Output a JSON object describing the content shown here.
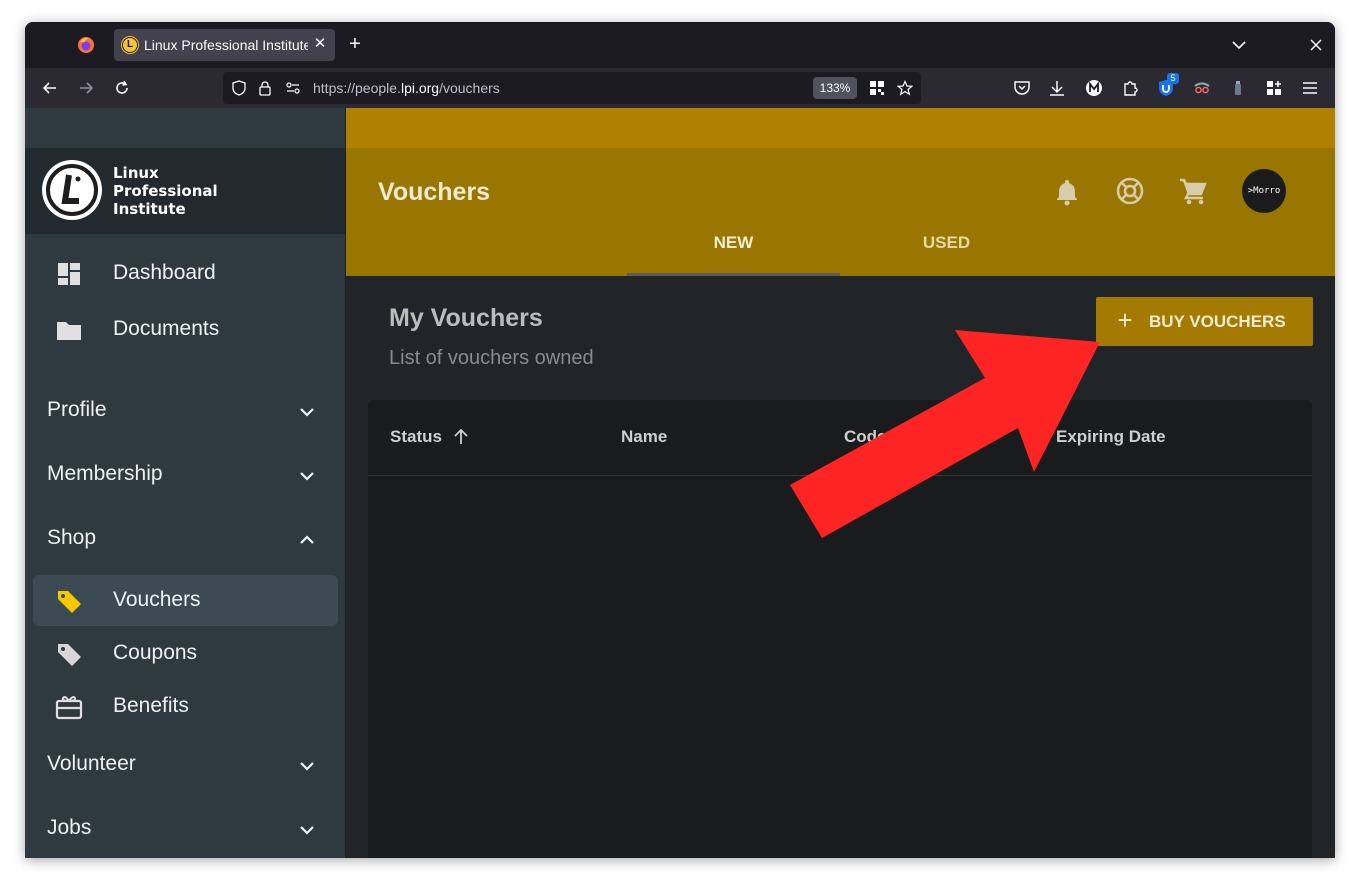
{
  "browser": {
    "tab_title": "Linux Professional Institute",
    "tab_favicon": "L",
    "url_prefix": "https://people.",
    "url_host": "lpi.org",
    "url_path": "/vouchers",
    "zoom": "133%",
    "extension_badge": "5"
  },
  "logo": {
    "line1": "Linux",
    "line2": "Professional",
    "line3": "Institute"
  },
  "sidebar": {
    "dashboard": "Dashboard",
    "documents": "Documents",
    "profile": "Profile",
    "membership": "Membership",
    "shop": "Shop",
    "vouchers": "Vouchers",
    "coupons": "Coupons",
    "benefits": "Benefits",
    "volunteer": "Volunteer",
    "jobs": "Jobs"
  },
  "header": {
    "title": "Vouchers",
    "avatar_text": ">Morro",
    "tabs": {
      "new": "NEW",
      "used": "USED"
    }
  },
  "main": {
    "title": "My Vouchers",
    "subtitle": "List of vouchers owned",
    "buy_button": "BUY VOUCHERS",
    "columns": {
      "status": "Status",
      "name": "Name",
      "code": "Code",
      "expiring": "Expiring Date"
    }
  },
  "colors": {
    "header_gold": "#987600",
    "strip_gold": "#b08000",
    "button_gold": "#a47a00",
    "sidebar_bg": "#2f3a40",
    "annotation_red": "#ff2222"
  }
}
